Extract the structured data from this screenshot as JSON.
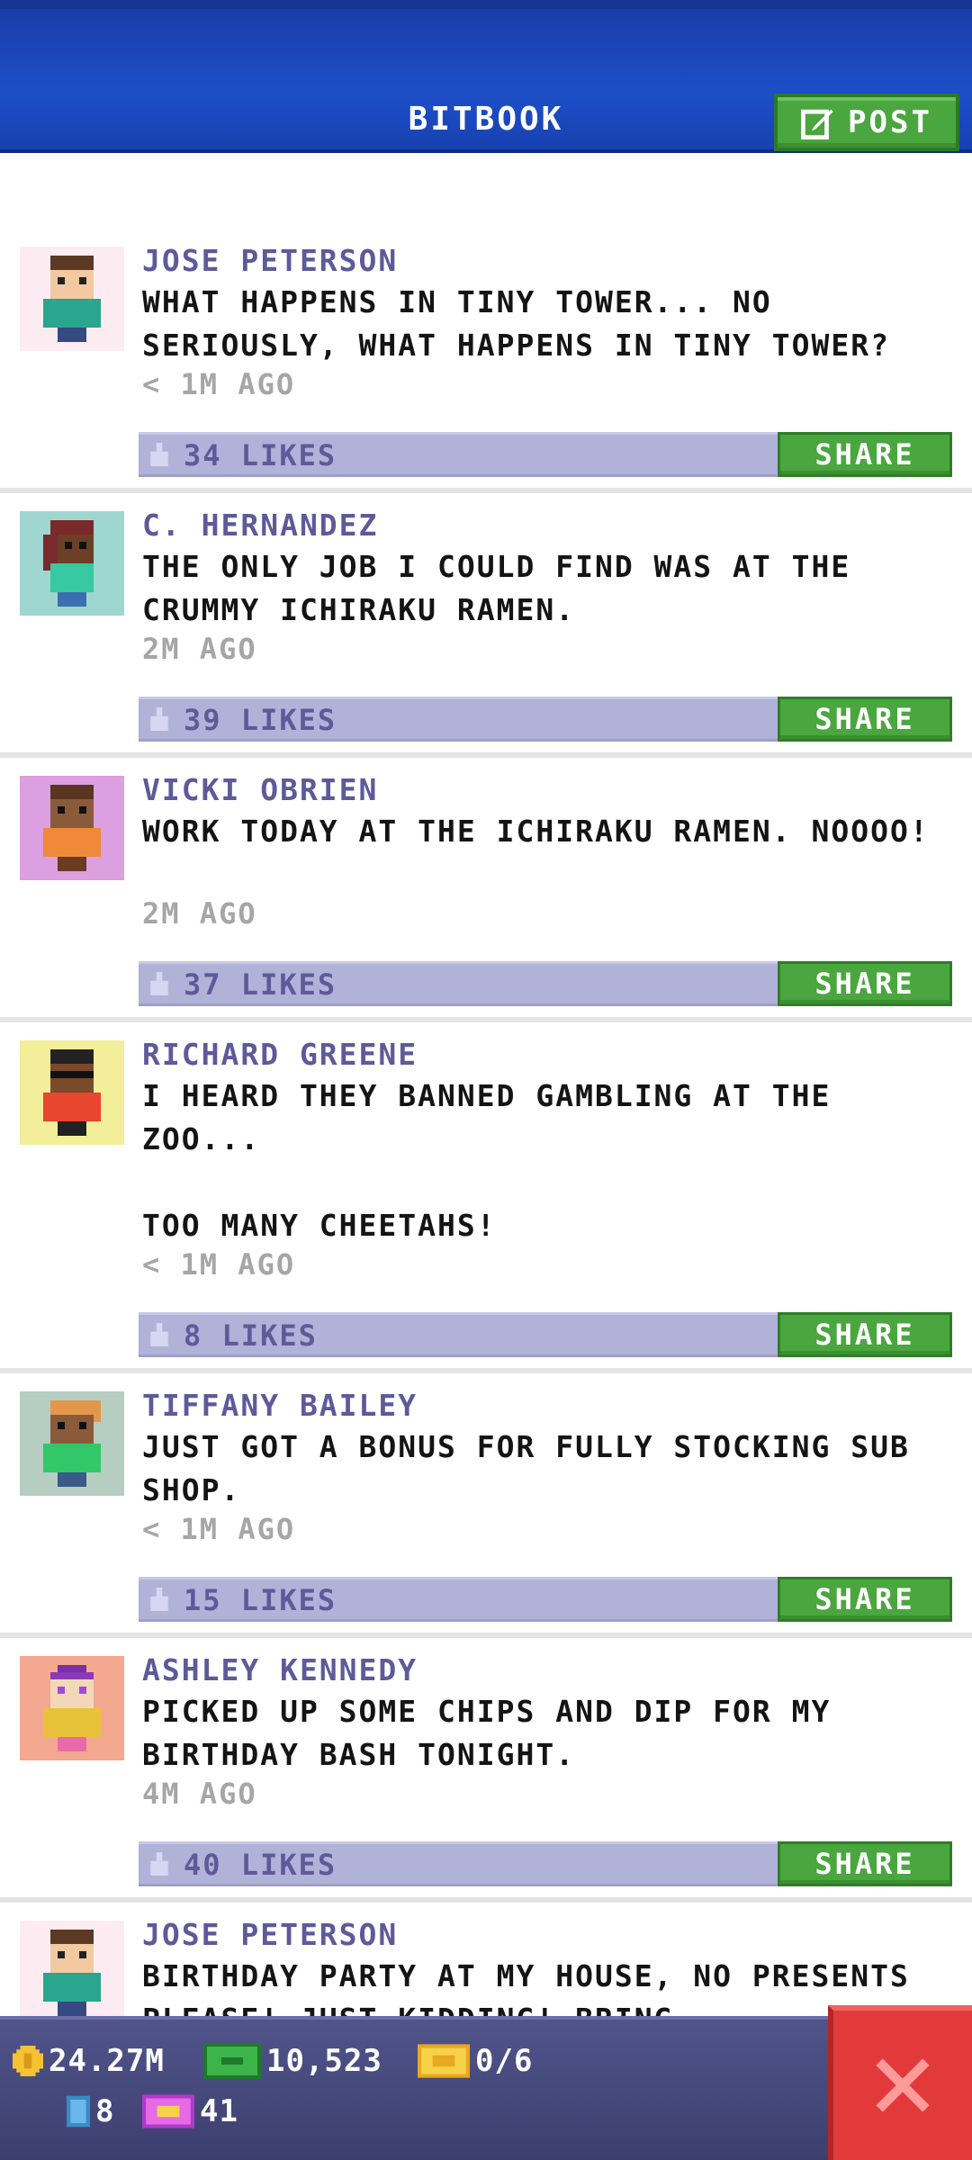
{
  "header": {
    "title": "BITBOOK",
    "post_label": "POST"
  },
  "posts": [
    {
      "name": "JOSE PETERSON",
      "message": "WHAT HAPPENS IN TINY TOWER... NO SERIOUSLY, WHAT HAPPENS IN TINY TOWER?",
      "time": "< 1M AGO",
      "likes": "34 LIKES",
      "share": "SHARE",
      "avatar_bg": "#fcecf2"
    },
    {
      "name": "C. HERNANDEZ",
      "message": "THE ONLY JOB I COULD FIND WAS AT THE CRUMMY ICHIRAKU RAMEN.",
      "time": "2M AGO",
      "likes": "39 LIKES",
      "share": "SHARE",
      "avatar_bg": "#9fd6d0"
    },
    {
      "name": "VICKI OBRIEN",
      "message": "WORK TODAY AT THE ICHIRAKU RAMEN. NOOOO!",
      "time": "2M AGO",
      "likes": "37 LIKES",
      "share": "SHARE",
      "avatar_bg": "#dc9fe0"
    },
    {
      "name": "RICHARD GREENE",
      "message": "I HEARD THEY BANNED GAMBLING AT THE ZOO...\n\nTOO MANY CHEETAHS!",
      "time": "< 1M AGO",
      "likes": "8 LIKES",
      "share": "SHARE",
      "avatar_bg": "#f2ee9a"
    },
    {
      "name": "TIFFANY BAILEY",
      "message": "JUST GOT A BONUS FOR FULLY STOCKING SUB SHOP.",
      "time": "< 1M AGO",
      "likes": "15 LIKES",
      "share": "SHARE",
      "avatar_bg": "#b6cdc2"
    },
    {
      "name": "ASHLEY KENNEDY",
      "message": "PICKED UP SOME CHIPS AND DIP FOR MY BIRTHDAY BASH TONIGHT.",
      "time": "4M AGO",
      "likes": "40 LIKES",
      "share": "SHARE",
      "avatar_bg": "#f4a890"
    },
    {
      "name": "JOSE PETERSON",
      "message": "BIRTHDAY PARTY AT MY HOUSE, NO PRESENTS PLEASE! JUST KIDDING! BRING",
      "avatar_bg": "#fcecf2"
    }
  ],
  "footer": {
    "coins": "24.27M",
    "bux": "10,523",
    "tickets": "0/6",
    "elevator_count": "8",
    "vip_count": "41"
  },
  "icons": [
    "post-edit-icon",
    "like-icon",
    "coin-icon",
    "bux-icon",
    "ticket-icon",
    "elevator-icon",
    "vip-icon",
    "close-icon"
  ]
}
